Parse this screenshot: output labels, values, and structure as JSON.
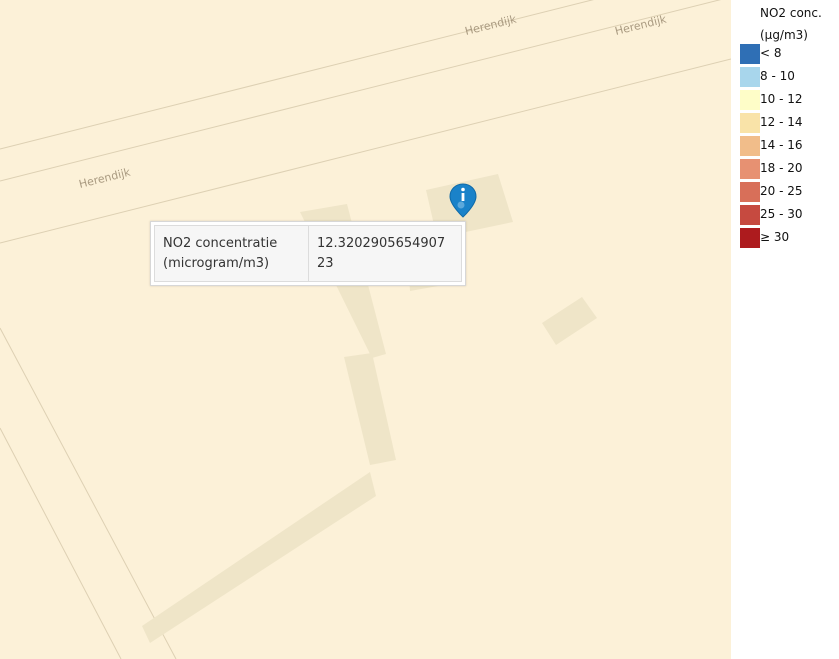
{
  "map": {
    "road_labels": [
      "Herendijk",
      "Herendijk",
      "Herendijk"
    ],
    "marker_icon": "info-marker-icon"
  },
  "popup": {
    "rows": [
      {
        "key": "NO2 concentratie (microgram/m3)",
        "value": "12.320290565490723"
      }
    ]
  },
  "legend": {
    "title_line1": "NO2 conc.",
    "title_line2": "(µg/m3)",
    "items": [
      {
        "label": "< 8",
        "color": "#2f6fb5"
      },
      {
        "label": "8 - 10",
        "color": "#a8d6ec"
      },
      {
        "label": "10 - 12",
        "color": "#fefdc8"
      },
      {
        "label": "12 - 14",
        "color": "#f9e3a8"
      },
      {
        "label": "14 - 16",
        "color": "#f1bd8a"
      },
      {
        "label": "18 - 20",
        "color": "#e79172"
      },
      {
        "label": "20 - 25",
        "color": "#d86f59"
      },
      {
        "label": "25 - 30",
        "color": "#c64a40"
      },
      {
        "label": "≥ 30",
        "color": "#ad1b1e"
      }
    ]
  }
}
